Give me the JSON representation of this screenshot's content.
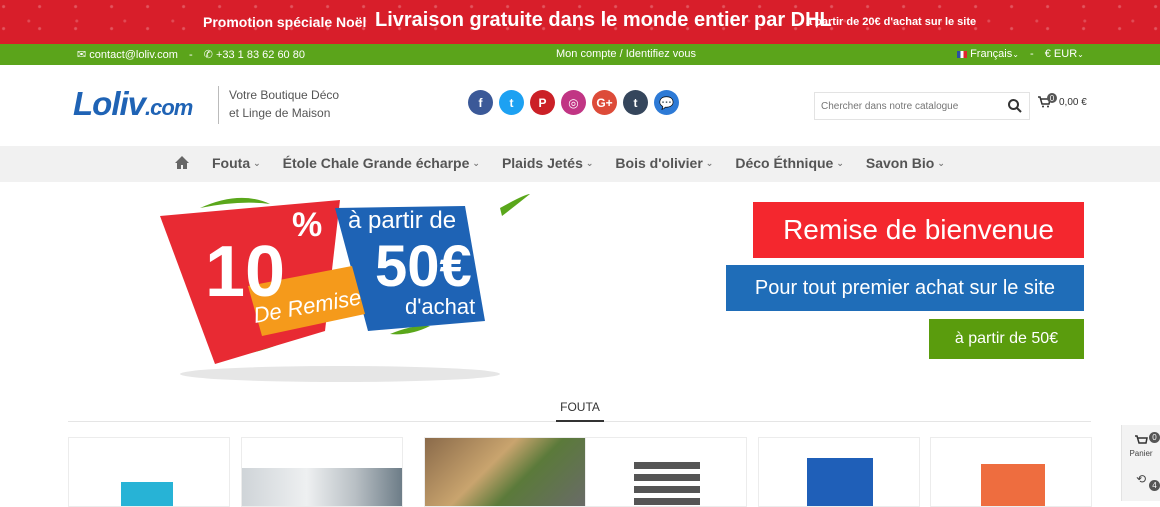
{
  "promo_bar": {
    "left": "Promotion spéciale Noël",
    "main": "Livraison gratuite dans le monde entier par DHL",
    "right": "à partir de 20€ d'achat sur le site"
  },
  "topbar": {
    "email": "contact@loliv.com",
    "phone": "+33 1 83 62 60 80",
    "account": "Mon compte / Identifiez vous",
    "language": "Français",
    "currency": "€ EUR"
  },
  "header": {
    "logo_main": "Loliv",
    "logo_domain": ".com",
    "tagline_line1": "Votre Boutique Déco",
    "tagline_line2": "et Linge de Maison",
    "search_placeholder": "Chercher dans notre catalogue",
    "cart_count": "0",
    "cart_total": "0,00 €"
  },
  "socials": [
    {
      "name": "facebook-icon",
      "glyph": "f",
      "color": "#3b5998"
    },
    {
      "name": "twitter-icon",
      "glyph": "t",
      "color": "#1da1f2"
    },
    {
      "name": "pinterest-icon",
      "glyph": "P",
      "color": "#cb2027"
    },
    {
      "name": "instagram-icon",
      "glyph": "◎",
      "color": "#c13584"
    },
    {
      "name": "google-plus-icon",
      "glyph": "G+",
      "color": "#dd4b39"
    },
    {
      "name": "tumblr-icon",
      "glyph": "t",
      "color": "#35465c"
    },
    {
      "name": "chat-icon",
      "glyph": "💬",
      "color": "#2d7ad6"
    }
  ],
  "nav": {
    "items": [
      "Fouta",
      "Étole Chale Grande écharpe",
      "Plaids Jetés",
      "Bois d'olivier",
      "Déco Éthnique",
      "Savon Bio"
    ]
  },
  "promo_graphic": {
    "percent": "10",
    "percent_sign": "%",
    "from_label": "à partir de",
    "amount": "50€",
    "discount_label": "De Remise",
    "purchase_label": "d'achat"
  },
  "welcome": {
    "title": "Remise de bienvenue",
    "subtitle": "Pour tout premier achat sur le site",
    "threshold": "à partir de 50€"
  },
  "section": {
    "title": "FOUTA"
  },
  "side_panel": {
    "cart_label": "Panier",
    "cart_count": "0",
    "history_count": "4"
  },
  "colors": {
    "promo_red": "#d81e2a",
    "green": "#5ba41b",
    "brand_blue": "#1f63b5"
  }
}
